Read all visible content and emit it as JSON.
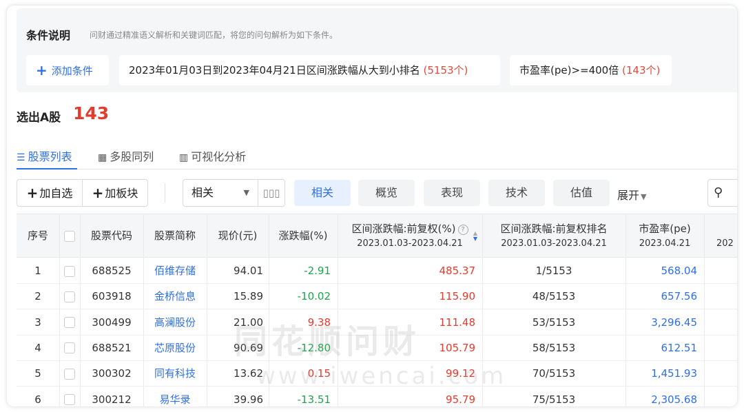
{
  "conditions": {
    "title": "条件说明",
    "description": "问财通过精准语义解析和关键词匹配，将您的问句解析为如下条件。",
    "add_label": "添加条件",
    "items": [
      {
        "text": "2023年01月03日到2023年04月21日区间涨跌幅从大到小排名",
        "count": "(5153个)"
      },
      {
        "text": "市盈率(pe)>=400倍",
        "count": "(143个)"
      }
    ]
  },
  "result": {
    "title": "选出A股",
    "count": "143"
  },
  "view_tabs": [
    {
      "label": "股票列表",
      "icon": "list-icon",
      "active": true
    },
    {
      "label": "多股同列",
      "icon": "grid-icon",
      "active": false
    },
    {
      "label": "可视化分析",
      "icon": "bar-chart-icon",
      "active": false
    }
  ],
  "toolbar": {
    "add_fav": "加自选",
    "add_block": "加板块",
    "select_value": "相关",
    "filter_tabs": [
      "相关",
      "概览",
      "表现",
      "技术",
      "估值"
    ],
    "active_filter": "相关",
    "expand_label": "展开"
  },
  "table": {
    "headers": {
      "idx": "序号",
      "code": "股票代码",
      "name": "股票简称",
      "price": "现价(元)",
      "change": "涨跌幅(%)",
      "range_change": "区间涨跌幅:前复权(%)",
      "range_change_sub": "2023.01.03-2023.04.21",
      "range_rank": "区间涨跌幅:前复权排名",
      "range_rank_sub": "2023.01.03-2023.04.21",
      "pe": "市盈率(pe)",
      "pe_sub": "2023.04.21",
      "extra_sub": "202"
    },
    "rows": [
      {
        "idx": "1",
        "code": "688525",
        "name": "佰维存储",
        "price": "94.01",
        "change": "-2.91",
        "range": "485.37",
        "rank": "1/5153",
        "pe": "568.04"
      },
      {
        "idx": "2",
        "code": "603918",
        "name": "金桥信息",
        "price": "15.89",
        "change": "-10.02",
        "range": "115.90",
        "rank": "48/5153",
        "pe": "657.56"
      },
      {
        "idx": "3",
        "code": "300499",
        "name": "高澜股份",
        "price": "21.00",
        "change": "9.38",
        "range": "111.48",
        "rank": "53/5153",
        "pe": "3,296.45"
      },
      {
        "idx": "4",
        "code": "688521",
        "name": "芯原股份",
        "price": "90.69",
        "change": "-12.80",
        "range": "105.79",
        "rank": "58/5153",
        "pe": "612.51"
      },
      {
        "idx": "5",
        "code": "300302",
        "name": "同有科技",
        "price": "13.62",
        "change": "0.15",
        "range": "99.12",
        "rank": "70/5153",
        "pe": "1,451.93"
      },
      {
        "idx": "6",
        "code": "300212",
        "name": "易华录",
        "price": "39.96",
        "change": "-13.51",
        "range": "95.79",
        "rank": "75/5153",
        "pe": "2,305.68"
      }
    ]
  },
  "watermark": {
    "cn": "同花顺问财",
    "en": "www.iwencai.com"
  },
  "colors": {
    "accent": "#2f6fe4",
    "up": "#e33b2e",
    "down": "#1ea34a"
  }
}
